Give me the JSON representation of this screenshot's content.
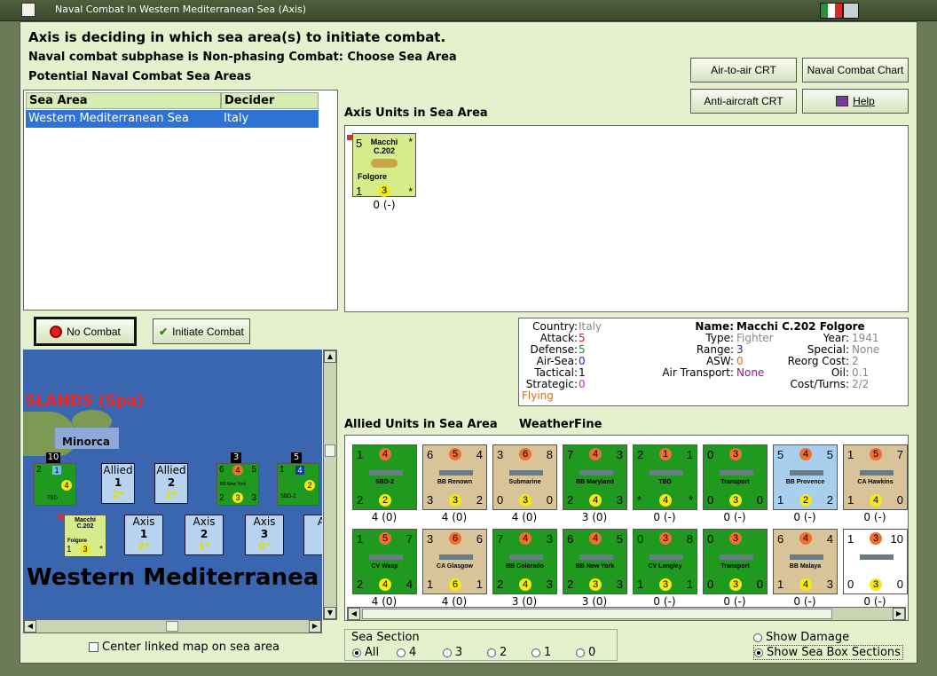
{
  "window": {
    "title": "Naval Combat In Western Mediterranean Sea (Axis)"
  },
  "header": {
    "line1": "Axis is deciding in which sea area(s) to initiate combat.",
    "line2": "Naval combat subphase is Non-phasing Combat: Choose Sea Area",
    "line3": "Potential Naval Combat Sea Areas"
  },
  "buttons": {
    "air_to_air": "Air-to-air CRT",
    "naval_chart": "Naval Combat Chart",
    "anti_aircraft": "Anti-aircraft CRT",
    "help": "Help",
    "no_combat": "No Combat",
    "initiate_combat": "Initiate Combat"
  },
  "sea_table": {
    "headers": [
      "Sea Area",
      "Decider"
    ],
    "rows": [
      {
        "sea_area": "Western Mediterranean Sea",
        "decider": "Italy"
      }
    ]
  },
  "axis_units": {
    "title": "Axis Units in Sea Area",
    "unit": {
      "attack": "5",
      "name1": "Macchi",
      "name2": "C.202",
      "name3": "Folgore",
      "aa": "1",
      "range": "3",
      "star": "*",
      "star2": "*",
      "caption": "0 (-)"
    }
  },
  "info": {
    "country_label": "Country:",
    "country": "Italy",
    "attack_label": "Attack:",
    "attack": "5",
    "defense_label": "Defense:",
    "defense": "5",
    "airsea_label": "Air-Sea:",
    "airsea": "0",
    "tactical_label": "Tactical:",
    "tactical": "1",
    "strategic_label": "Strategic:",
    "strategic": "0",
    "flying": "Flying",
    "name_label": "Name:",
    "name": "Macchi C.202 Folgore",
    "type_label": "Type:",
    "type": "Fighter",
    "range_label": "Range:",
    "range": "3",
    "asw_label": "ASW:",
    "asw": "0",
    "airtrans_label": "Air Transport:",
    "airtrans": "None",
    "year_label": "Year:",
    "year": "1941",
    "special_label": "Special:",
    "special": "None",
    "reorg_label": "Reorg Cost:",
    "reorg": "2",
    "oil_label": "Oil:",
    "oil": "0.1",
    "cost_label": "Cost/Turns:",
    "cost": "2/2"
  },
  "allied": {
    "title": "Allied Units in Sea Area",
    "weather_label": "Weather:",
    "weather": "Fine",
    "row1": [
      {
        "tl": "1",
        "tm": "4",
        "tr": "",
        "name": "SBD-2",
        "bl": "2",
        "bm": "2",
        "br": "",
        "caption": "4 (0)",
        "bg": "#1f9a1f"
      },
      {
        "tl": "6",
        "tm": "5",
        "tr": "4",
        "name": "BB Renown",
        "bl": "3",
        "bm": "3",
        "br": "2",
        "caption": "4 (0)",
        "bg": "#d9c49a"
      },
      {
        "tl": "3",
        "tm": "6",
        "tr": "8",
        "name": "Submarine",
        "bl": "0",
        "bm": "3",
        "br": "0",
        "caption": "4 (0)",
        "bg": "#d9c49a"
      },
      {
        "tl": "7",
        "tm": "4",
        "tr": "3",
        "name": "BB Maryland",
        "bl": "2",
        "bm": "4",
        "br": "3",
        "caption": "3 (0)",
        "bg": "#1f9a1f"
      },
      {
        "tl": "2",
        "tm": "1",
        "tr": "1",
        "name": "TBD",
        "bl": "*",
        "bm": "4",
        "br": "*",
        "caption": "0 (-)",
        "bg": "#1f9a1f"
      },
      {
        "tl": "0",
        "tm": "3",
        "tr": "",
        "name": "Transport",
        "bl": "0",
        "bm": "3",
        "br": "0",
        "caption": "0 (-)",
        "bg": "#1f9a1f"
      },
      {
        "tl": "5",
        "tm": "4",
        "tr": "5",
        "name": "BB Provence",
        "bl": "1",
        "bm": "2",
        "br": "2",
        "caption": "0 (-)",
        "bg": "#a8d0ee"
      },
      {
        "tl": "1",
        "tm": "5",
        "tr": "7",
        "name": "CA Hawkins",
        "bl": "1",
        "bm": "4",
        "br": "0",
        "caption": "0 (-)",
        "bg": "#d9c49a"
      }
    ],
    "row2": [
      {
        "tl": "1",
        "tm": "5",
        "tr": "7",
        "name": "CV Wasp",
        "bl": "2",
        "bm": "4",
        "br": "4",
        "caption": "4 (0)",
        "bg": "#1f9a1f"
      },
      {
        "tl": "3",
        "tm": "6",
        "tr": "6",
        "name": "CA Glasgow",
        "bl": "1",
        "bm": "6",
        "br": "1",
        "caption": "4 (0)",
        "bg": "#d9c49a"
      },
      {
        "tl": "7",
        "tm": "4",
        "tr": "3",
        "name": "BB Colorado",
        "bl": "2",
        "bm": "4",
        "br": "3",
        "caption": "3 (0)",
        "bg": "#1f9a1f"
      },
      {
        "tl": "6",
        "tm": "4",
        "tr": "5",
        "name": "BB New York",
        "bl": "2",
        "bm": "3",
        "br": "3",
        "caption": "3 (0)",
        "bg": "#1f9a1f"
      },
      {
        "tl": "0",
        "tm": "3",
        "tr": "8",
        "name": "CV Langley",
        "bl": "1",
        "bm": "3",
        "br": "1",
        "caption": "0 (-)",
        "bg": "#1f9a1f"
      },
      {
        "tl": "0",
        "tm": "3",
        "tr": "",
        "name": "Transport",
        "bl": "0",
        "bm": "3",
        "br": "0",
        "caption": "0 (-)",
        "bg": "#1f9a1f"
      },
      {
        "tl": "6",
        "tm": "4",
        "tr": "4",
        "name": "BB Malaya",
        "bl": "1",
        "bm": "4",
        "br": "3",
        "caption": "0 (-)",
        "bg": "#d9c49a"
      },
      {
        "tl": "1",
        "tm": "3",
        "tr": "10",
        "name": "",
        "bl": "0",
        "bm": "3",
        "br": "0",
        "caption": "0 (-)",
        "bg": "#ffffff"
      }
    ]
  },
  "map": {
    "islands_label": "SLANDS (Spa)",
    "minorca": "Minorca",
    "sea_name": "Western Mediterranea",
    "allied_box1": {
      "label": "Allied",
      "num": "1",
      "sub": "2*"
    },
    "allied_box2": {
      "label": "Allied",
      "num": "2",
      "sub": "1*"
    },
    "axis_box1": {
      "label": "Axis",
      "num": "1",
      "sub": "2*"
    },
    "axis_box2": {
      "label": "Axis",
      "num": "2",
      "sub": "1*"
    },
    "axis_box3": {
      "label": "Axis",
      "num": "3",
      "sub": "0*"
    },
    "axis_box4": {
      "label": "A"
    },
    "stack_tbd": {
      "count": "10",
      "tl": "2",
      "tm": "1",
      "name": "TBD",
      "bm": "4"
    },
    "stack_bb": {
      "count": "3",
      "tl": "6",
      "tm": "4",
      "tr": "5",
      "name": "BB New York",
      "bl": "2",
      "bm": "3",
      "br": "3"
    },
    "stack_sbd": {
      "count": "5",
      "tl": "1",
      "tm": "4",
      "name": "SBD-2",
      "bl": "2",
      "bm": "2"
    },
    "stack_macchi": {
      "n1": "Macchi",
      "n2": "C.202",
      "n3": "Folgore",
      "tl": "1",
      "tm": "3",
      "star": "*"
    }
  },
  "footer": {
    "center_map": "Center linked map on sea area",
    "sea_section_label": "Sea Section",
    "sea_options": [
      "All",
      "4",
      "3",
      "2",
      "1",
      "0"
    ],
    "show_damage": "Show Damage",
    "show_sections": "Show Sea Box Sections"
  }
}
